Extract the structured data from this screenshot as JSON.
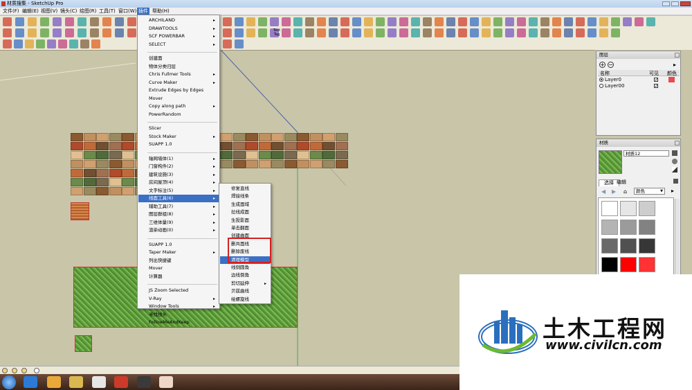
{
  "window": {
    "title": "材质搜集 - SketchUp Pro"
  },
  "menubar": {
    "items": [
      {
        "label": "文件(F)"
      },
      {
        "label": "编辑(E)"
      },
      {
        "label": "视图(V)"
      },
      {
        "label": "镜头(C)"
      },
      {
        "label": "绘图(R)"
      },
      {
        "label": "工具(T)"
      },
      {
        "label": "窗口(W)"
      },
      {
        "label": "插件"
      },
      {
        "label": "帮助(H)"
      }
    ],
    "active": "插件"
  },
  "toolbar": {
    "text_tag": "Text Tag"
  },
  "plugins_menu": {
    "items": [
      {
        "label": "ARCHILAND",
        "sub": true
      },
      {
        "label": "DRAWTOOLS",
        "sub": true
      },
      {
        "label": "SCF POWERBAR",
        "sub": true
      },
      {
        "label": "SELECT",
        "sub": true
      },
      {
        "sep": true
      },
      {
        "label": "创建面",
        "sub": false
      },
      {
        "label": "物体分类归层",
        "sub": false
      },
      {
        "label": "Chris Fullmer Tools",
        "sub": true
      },
      {
        "label": "Curve Maker",
        "sub": true
      },
      {
        "label": "Extrude Edges by Edges",
        "sub": false
      },
      {
        "label": "Mover",
        "sub": false
      },
      {
        "label": "Copy along path",
        "sub": true
      },
      {
        "label": "PowerRandom",
        "sub": false
      },
      {
        "sep": true
      },
      {
        "label": "Slicer",
        "sub": false
      },
      {
        "label": "Stock Maker",
        "sub": true
      },
      {
        "label": "SUAPP 1.0",
        "sub": false
      },
      {
        "sep": true
      },
      {
        "label": "轴网墙体(1)",
        "sub": true
      },
      {
        "label": "门窗构件(2)",
        "sub": true
      },
      {
        "label": "建筑设施(3)",
        "sub": true
      },
      {
        "label": "房间屋顶(4)",
        "sub": true
      },
      {
        "label": "文字标注(5)",
        "sub": true
      },
      {
        "label": "线面工具(6)",
        "sub": true,
        "highlighted": true
      },
      {
        "label": "辅助工具(7)",
        "sub": true
      },
      {
        "label": "图层群组(8)",
        "sub": true
      },
      {
        "label": "三维体量(9)",
        "sub": true
      },
      {
        "label": "渲染动画(0)",
        "sub": true
      },
      {
        "sep": true
      },
      {
        "label": "SUAPP 1.0",
        "sub": false
      },
      {
        "label": "Taper Maker",
        "sub": true
      },
      {
        "label": "列出快捷键",
        "sub": false
      },
      {
        "label": "Mover",
        "sub": false
      },
      {
        "label": "计算器",
        "sub": false
      },
      {
        "sep": true
      },
      {
        "label": "JS Zoom Selected",
        "sub": false
      },
      {
        "label": "V-Ray",
        "sub": true
      },
      {
        "label": "Window Tools",
        "sub": true
      },
      {
        "label": "寻找线头",
        "sub": false
      },
      {
        "label": "FollowMeAndKeep",
        "sub": false
      }
    ]
  },
  "line_tools_submenu": {
    "items": [
      {
        "label": "修复直线"
      },
      {
        "label": "焊接线条"
      },
      {
        "label": "生成面域"
      },
      {
        "label": "拉线成面"
      },
      {
        "label": "生投影面"
      },
      {
        "label": "单击翻面"
      },
      {
        "label": "创建曲面"
      },
      {
        "label": "删共面线"
      },
      {
        "label": "删除废线"
      },
      {
        "label": "清理模型",
        "highlighted": true
      },
      {
        "label": "线倒圆角"
      },
      {
        "label": "边线倒角"
      },
      {
        "label": "剪切延伸",
        "sub": true
      },
      {
        "label": "贝兹曲线"
      },
      {
        "label": "绘螺旋线"
      }
    ]
  },
  "layers_panel": {
    "title": "图层",
    "columns": {
      "name": "名称",
      "visible": "可见",
      "color": "颜色"
    },
    "rows": [
      {
        "name": "Layer0",
        "active": true,
        "visible": true,
        "color": "#e84b4b"
      },
      {
        "name": "Layer00",
        "active": false,
        "visible": true,
        "color": ""
      }
    ]
  },
  "materials_panel": {
    "title": "材质",
    "current_name": "材质12",
    "tabs": [
      {
        "label": "选择"
      },
      {
        "label": "编辑"
      }
    ],
    "library": "颜色",
    "swatches": [
      "#ffffff",
      "#e6e6e6",
      "#cdcdcd",
      "#b4b4b4",
      "#9b9b9b",
      "#828282",
      "#696969",
      "#505050",
      "#373737",
      "#000000",
      "#ff0000",
      "#ff3333"
    ]
  },
  "watermark": {
    "brand": "土木工程网",
    "url": "www.civilcn.com"
  }
}
